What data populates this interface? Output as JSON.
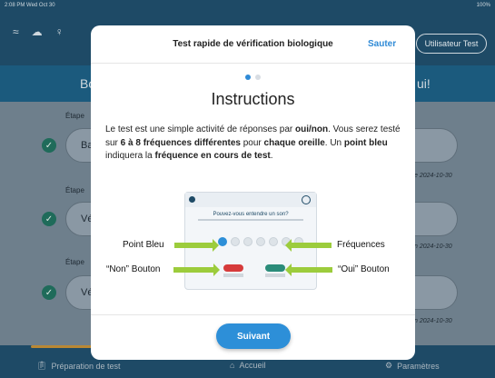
{
  "statusbar": {
    "time": "2:08 PM  Wed Oct 30",
    "battery": "100%"
  },
  "topbar": {
    "user_button": "Utilisateur Test"
  },
  "banner": {
    "left_text": "Bo",
    "right_text": "ui!"
  },
  "steps": [
    {
      "label": "Étape",
      "pill": "Ba",
      "date": "e 2024-10-30"
    },
    {
      "label": "Étape",
      "pill": "Vé",
      "date": "n 2024-10-30"
    },
    {
      "label": "Étape",
      "pill": "Vé",
      "date": "n 2024-10-30"
    }
  ],
  "bottomnav": {
    "tab1": "Préparation de test",
    "tab2": "Accueil",
    "tab3": "Paramètres"
  },
  "modal": {
    "title": "Test rapide de vérification biologique",
    "skip": "Sauter",
    "heading": "Instructions",
    "para_1": "Le test est une simple activité de réponses par ",
    "para_b1": "oui/non",
    "para_2": ". Vous serez testé sur ",
    "para_b2": "6 à 8 fréquences différentes",
    "para_3": " pour ",
    "para_b3": "chaque oreille",
    "para_4": ". Un ",
    "para_b4": "point bleu",
    "para_5": " indiquera la ",
    "para_b5": "fréquence en cours de test",
    "para_6": ".",
    "next": "Suivant"
  },
  "illustration": {
    "question": "Pouvez-vous entendre un son?",
    "callout_point": "Point Bleu",
    "callout_freq": "Fréquences",
    "callout_non": "“Non” Bouton",
    "callout_oui": "“Oui” Bouton",
    "btn_non": "Non",
    "btn_oui": "Oui"
  }
}
